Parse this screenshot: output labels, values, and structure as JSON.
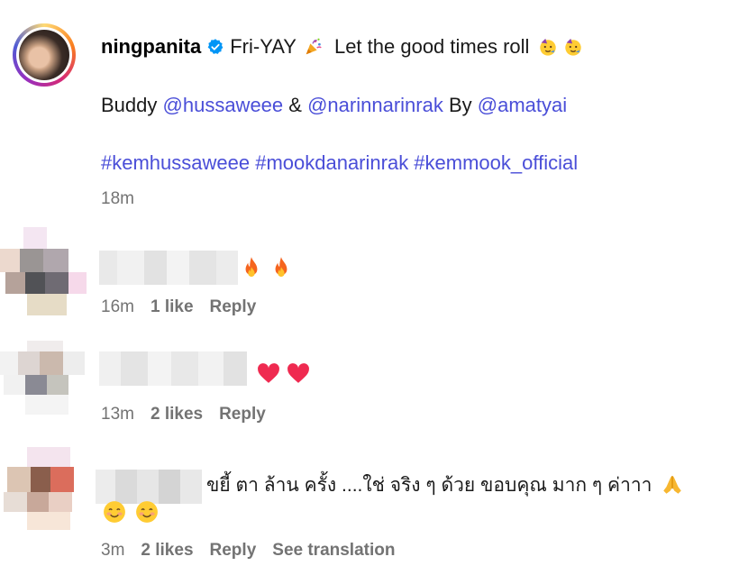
{
  "post": {
    "username": "ningpanita",
    "caption": "Fri-YAY",
    "caption_rest": "Let the good times roll",
    "line2_prefix": "Buddy",
    "mention1": "@hussaweee",
    "amp": "&",
    "mention2": "@narinnarinrak",
    "by": "By",
    "mention3": "@amatyai",
    "hashtags": "#kemhussaweee #mookdanarinrak #kemmook_official",
    "time": "18m",
    "icons": [
      "verified-badge-icon",
      "party-popper-icon",
      "partying-face-icon"
    ]
  },
  "comments": [
    {
      "time": "16m",
      "likes": "1 like",
      "reply": "Reply",
      "icons": [
        "fire-icon",
        "fire-icon"
      ]
    },
    {
      "time": "13m",
      "likes": "2 likes",
      "reply": "Reply",
      "icons": [
        "red-heart-icon",
        "red-heart-icon"
      ]
    },
    {
      "text": "ขยี้ ตา ล้าน ครั้ง ....ใช่ จริง ๆ ด้วย ขอบคุณ มาก ๆ ค่าาา",
      "time": "3m",
      "likes": "2 likes",
      "reply": "Reply",
      "see_translation": "See translation",
      "icons": [
        "folded-hands-icon",
        "smiling-face-icon",
        "smiling-face-icon"
      ]
    }
  ],
  "colors": {
    "link": "#4a4ed8",
    "muted": "#737373",
    "verified": "#0095f6"
  }
}
